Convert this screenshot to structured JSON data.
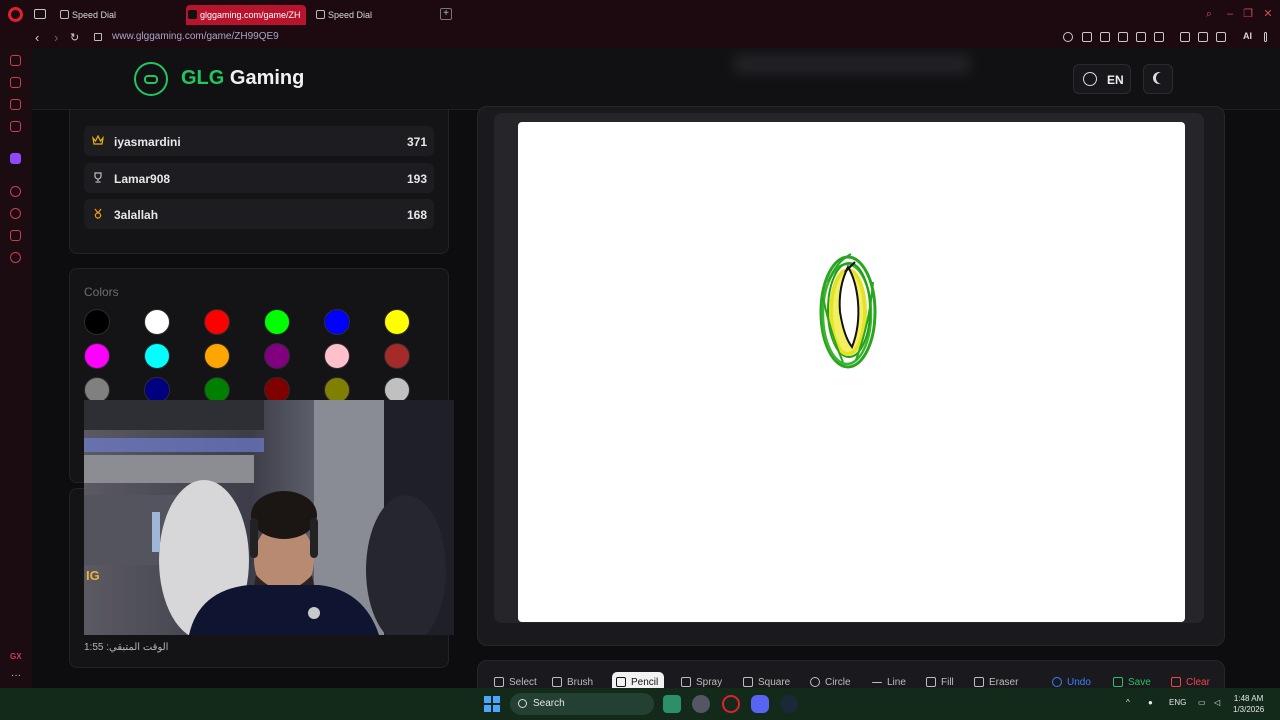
{
  "browser": {
    "tabs": [
      {
        "label": "Speed Dial",
        "active": false
      },
      {
        "label": "glggaming.com/game/ZH",
        "active": true
      },
      {
        "label": "Speed Dial",
        "active": false
      }
    ],
    "url": "www.glggaming.com/game/ZH99QE9",
    "ai_label": "AI"
  },
  "header": {
    "brand_prefix": "GLG",
    "brand_suffix": " Gaming",
    "language": "EN",
    "icons": [
      "gamepad-icon",
      "globe-icon",
      "moon-icon"
    ]
  },
  "leaderboard": [
    {
      "name": "iyasmardini",
      "score": "371",
      "icon": "crown-icon",
      "icon_color": "#eab308"
    },
    {
      "name": "Lamar908",
      "score": "193",
      "icon": "trophy-icon",
      "icon_color": "#bdbdbd"
    },
    {
      "name": "3alallah",
      "score": "168",
      "icon": "medal-icon",
      "icon_color": "#f59e0b"
    }
  ],
  "colors": {
    "title": "Colors",
    "swatches": [
      "#000000",
      "#ffffff",
      "#ff0000",
      "#00ff00",
      "#0000ff",
      "#ffff00",
      "#ff00ff",
      "#00ffff",
      "#ffa500",
      "#800080",
      "#ffc0cb",
      "#a52a2a",
      "#808080",
      "#000080",
      "#008000",
      "#800000",
      "#808000",
      "#c0c0c0"
    ]
  },
  "timer": {
    "text": "الوقت المتبقي: 1:55"
  },
  "toolbar": {
    "tools": [
      {
        "label": "Select",
        "icon": "cursor-icon"
      },
      {
        "label": "Brush",
        "icon": "brush-icon"
      },
      {
        "label": "Pencil",
        "icon": "pencil-icon",
        "active": true
      },
      {
        "label": "Spray",
        "icon": "spray-icon"
      },
      {
        "label": "Square",
        "icon": "square-icon"
      },
      {
        "label": "Circle",
        "icon": "circle-icon"
      },
      {
        "label": "Line",
        "icon": "line-icon"
      },
      {
        "label": "Fill",
        "icon": "fill-icon"
      },
      {
        "label": "Eraser",
        "icon": "eraser-icon"
      }
    ],
    "undo": "Undo",
    "save": "Save",
    "clear": "Clear"
  },
  "taskbar": {
    "search": "Search",
    "lang": "ENG",
    "time": "1:48 AM",
    "date": "1/3/2026"
  },
  "theme": {
    "accent": "#22c55e",
    "tab_active": "#b8142e",
    "undo_color": "#3b82f6",
    "clear_color": "#ef4444"
  }
}
